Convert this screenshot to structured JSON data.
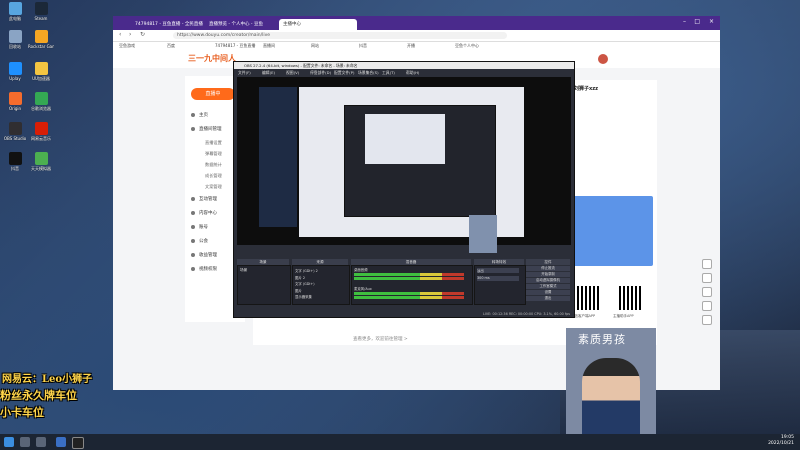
{
  "desktop": {
    "icons": [
      {
        "label": "此电脑",
        "color": "#58a6e0"
      },
      {
        "label": "Steam",
        "color": "#1b2838"
      },
      {
        "label": "回收站",
        "color": "#8aa4c4"
      },
      {
        "label": "Rockstar Games",
        "color": "#f5a623"
      },
      {
        "label": "Uplay",
        "color": "#1e90ff"
      },
      {
        "label": "UU加速器",
        "color": "#f4c542"
      },
      {
        "label": "Origin",
        "color": "#f56c2d"
      },
      {
        "label": "谷歌浏览器",
        "color": "#34a853"
      },
      {
        "label": "OBS Studio",
        "color": "#302e31"
      },
      {
        "label": "网易云音乐",
        "color": "#d81e06"
      },
      {
        "label": "抖音",
        "color": "#111"
      },
      {
        "label": "天天模拟器",
        "color": "#4caf50"
      }
    ],
    "overlay_lines": [
      "网易云：Leo小狮子",
      "粉丝永久牌车位",
      "小卡车位"
    ],
    "taskbar_time": "19:05",
    "taskbar_date": "2022/10/21"
  },
  "browser": {
    "tabs": [
      {
        "label": "74794817 - 豆鱼直播 - 全民直播"
      },
      {
        "label": "直播预览 - 个人中心 - 豆鱼"
      },
      {
        "label": "主播中心"
      }
    ],
    "url": "https://www.douyu.com/creator/main/live",
    "bookmarks": [
      "豆鱼游戏",
      "百度",
      "74794817 - 豆鱼直播",
      "直播间",
      "网站",
      "抖音",
      "开播",
      "豆鱼个人中心"
    ],
    "site": {
      "logo": "三一九中间人",
      "live_button": "直播中",
      "menu": [
        {
          "label": "主页"
        },
        {
          "label": "直播间管理"
        },
        {
          "label": "互动管理"
        },
        {
          "label": "内容中心"
        },
        {
          "label": "账号"
        },
        {
          "label": "公会"
        },
        {
          "label": "收益管理"
        },
        {
          "label": "视频权限"
        }
      ],
      "submenu": [
        "直播设置",
        "弹幕管理",
        "数据统计",
        "成长管理",
        "文案管理"
      ],
      "username": "刘狮子xzz",
      "footer_link": "查看更多，欢迎前往管理 >",
      "qr_caption_1": "微信客户端APP",
      "qr_caption_2": "主播助手APP"
    }
  },
  "obs": {
    "title": "OBS 27.2.4 (64-bit, windows) - 配置文件: 未命名 - 场景: 未命名",
    "menu": [
      "文件(F)",
      "编辑(E)",
      "视图(V)",
      "停靠部件(D)",
      "配置文件(P)",
      "场景集合(S)",
      "工具(T)",
      "帮助(H)"
    ],
    "panels": {
      "scenes": "场景",
      "sources": "来源",
      "mixer": "混音器",
      "transitions": "转场特效",
      "controls": "控件"
    },
    "scene_item": "场景",
    "sources_list": [
      "文字 (GDI+) 2",
      "图片 2",
      "文字 (GDI+)",
      "图片",
      "显示器采集"
    ],
    "mixer_tracks": [
      "桌面音频",
      "麦克风/Aux"
    ],
    "transition_value": "淡出",
    "duration_value": "300 ms",
    "controls_buttons": [
      "停止推流",
      "开始录制",
      "启动虚拟摄像机",
      "工作室模式",
      "设置",
      "退出"
    ],
    "status": "LIVE: 00:12:36   REC: 00:00:00   CPU: 3.1%, 60.00 fps"
  },
  "webcam": {
    "caption": "素质男孩"
  }
}
